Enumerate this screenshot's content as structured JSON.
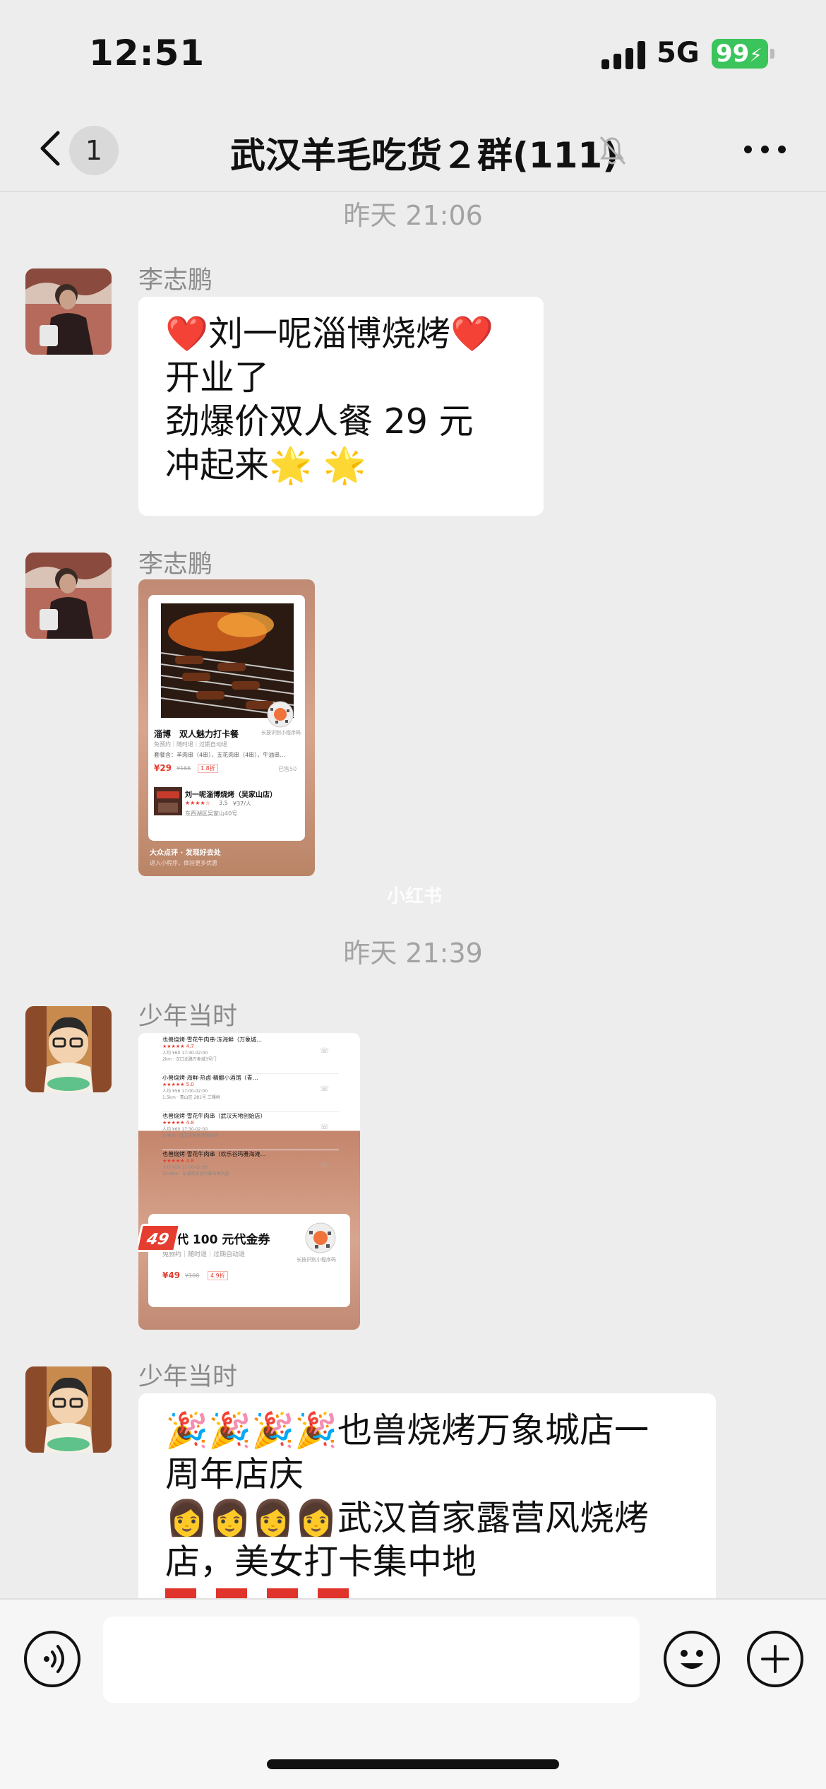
{
  "status_bar": {
    "time": "12:51",
    "network": "5G",
    "battery": "99"
  },
  "header": {
    "unread_count": "1",
    "title": "武汉羊毛吃货２群(111)"
  },
  "messages": [
    {
      "type": "timestamp",
      "text": "昨天 21:06"
    },
    {
      "type": "text",
      "sender": "李志鹏",
      "lines": [
        "❤️刘一呢淄博烧烤❤️",
        "开业了",
        "劲爆价双人餐 29 元",
        "冲起来🌟 🌟"
      ]
    },
    {
      "type": "image",
      "sender": "李志鹏",
      "card": {
        "deal_title": "淄博　双人魅力打卡餐",
        "deal_terms": "免预约｜随时退｜过期自动退",
        "deal_items": "套餐含：羊肉串（4串），五花肉串（4串），牛油串…",
        "price": "¥29",
        "old_price": "¥166",
        "discount": "1.8折",
        "sold": "已售50",
        "shop_name": "刘一呢淄博烧烤（吴家山店）",
        "shop_rating": "3.5",
        "shop_price": "¥37/人",
        "shop_address": "东西湖区吴家山40号",
        "qr_caption": "长按识别小程序码",
        "brand": "大众点评 · 发现好去处",
        "footer_caption": "进入小程序，体验更多优惠"
      }
    },
    {
      "type": "timestamp",
      "text": "昨天 21:39"
    },
    {
      "type": "image",
      "sender": "少年当时",
      "card": {
        "list": [
          {
            "name": "也兽烧烤·雪花牛肉串·冻海鲜（万象城…",
            "rating": "4.7",
            "line": "人均 ¥60  17:30-02:00",
            "addr": "2km · 汉口北路万象城3号门"
          },
          {
            "name": "小兽烧烤·海鲜·热卤·精酿小酒馆（青…",
            "rating": "5.0",
            "line": "人均 ¥56  17:00-02:00",
            "addr": "1.5km · 青山区 281号 三棵树"
          },
          {
            "name": "也兽烧烤·雪花牛肉串（武汉天地创始店）",
            "rating": "4.8",
            "line": "人均 ¥60  17:30-02:00",
            "addr": "3.4km · 武汉天地商务街88号"
          },
          {
            "name": "也兽烧烤·雪花牛肉串（欢乐谷玛雅海滩…",
            "rating": "4.8",
            "line": "人均 ¥56  17:00-02:00",
            "addr": "10.4km · 东湖欢乐谷玛雅海滩大道"
          }
        ],
        "badge": "49",
        "voucher_title": "代 100 元代金券",
        "voucher_terms": "免预约｜随时退｜过期自动退",
        "voucher_price": "¥49",
        "voucher_old_price": "¥100",
        "voucher_discount": "4.9折",
        "qr_caption": "长按识别小程序码"
      }
    },
    {
      "type": "text",
      "sender": "少年当时",
      "lines": [
        "🎉🎉🎉🎉也兽烧烤万象城店一",
        "周年店庆",
        "👩👩👩👩武汉首家露营风烧烤",
        "店，美女打卡集中地"
      ]
    }
  ],
  "watermark": "小红书",
  "colors": {
    "background": "#ededed",
    "bubble": "#ffffff",
    "battery": "#3bc45b",
    "timestamp": "#a3a3a3",
    "price_red": "#e53d2f"
  }
}
